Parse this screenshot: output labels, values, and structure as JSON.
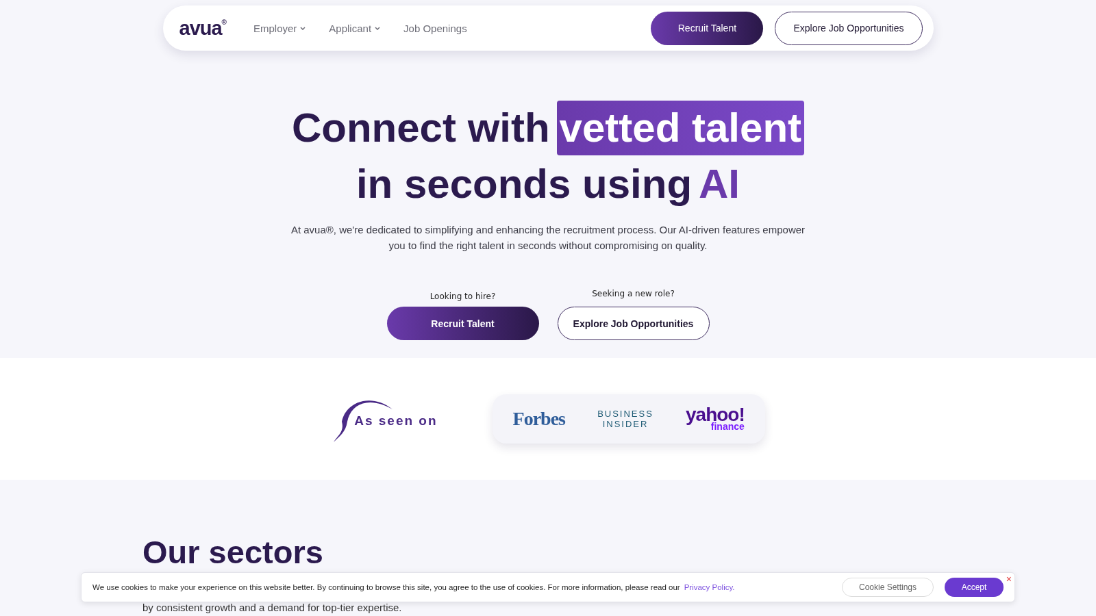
{
  "nav": {
    "logo": "avua",
    "logo_mark": "®",
    "links": [
      {
        "label": "Employer",
        "dropdown": true
      },
      {
        "label": "Applicant",
        "dropdown": true
      },
      {
        "label": "Job Openings",
        "dropdown": false
      }
    ],
    "primary_button": "Recruit Talent",
    "secondary_button": "Explore Job Opportunities"
  },
  "hero": {
    "title_start": "Connect with",
    "title_highlight": "vetted talent",
    "title_line2": "in seconds using",
    "title_accent": "AI",
    "description": "At avua®, we're dedicated to simplifying and enhancing the recruitment process. Our AI-driven features empower you to find the right talent in seconds without compromising on quality.",
    "ctas": [
      {
        "hint": "Looking to hire?",
        "label": "Recruit Talent",
        "kind": "primary"
      },
      {
        "hint": "Seeking a new role?",
        "label": "Explore Job Opportunities",
        "kind": "outline"
      }
    ]
  },
  "press": {
    "label": "As seen on",
    "logos": [
      {
        "kind": "forbes",
        "text": "Forbes"
      },
      {
        "kind": "insider",
        "text": "BUSINESS INSIDER"
      },
      {
        "kind": "yahoo",
        "text": "yahoo!",
        "sub": "finance"
      }
    ]
  },
  "sectors": {
    "title": "Our sectors",
    "text": "by consistent growth and a demand for top-tier expertise."
  },
  "cookie_banner": {
    "text": "We use cookies to make your experience on this website better. By continuing to browse this site, you agree to the use of cookies. For more information, please read our",
    "link": "Privacy Policy.",
    "settings_button": "Cookie Settings",
    "accept_button": "Accept",
    "close": "×"
  }
}
